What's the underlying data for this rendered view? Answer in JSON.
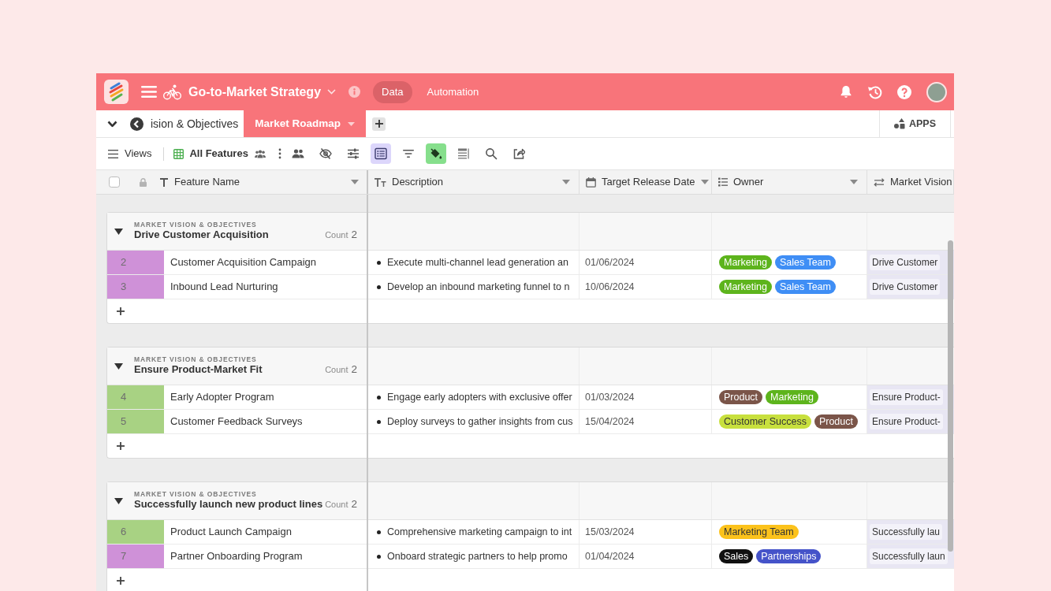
{
  "header": {
    "title": "Go-to-Market Strategy",
    "nav": [
      {
        "label": "Data",
        "selected": true
      },
      {
        "label": "Automation",
        "selected": false
      }
    ]
  },
  "tabs": {
    "items": [
      {
        "label": "ision & Objectives",
        "selected": false
      },
      {
        "label": "Market Roadmap",
        "selected": true
      }
    ],
    "apps_label": "APPS"
  },
  "toolbar": {
    "views_label": "Views",
    "view_name": "All Features",
    "tools": [
      {
        "active": false
      },
      {
        "active": false
      },
      {
        "active": false
      },
      {
        "active": true
      },
      {
        "active": false
      },
      {
        "active": true
      },
      {
        "active": false
      },
      {
        "active": false
      },
      {
        "active": false
      }
    ]
  },
  "table": {
    "select_all": {
      "checked": false
    },
    "columns": [
      {
        "kind": "text",
        "label": "Feature Name"
      },
      {
        "kind": "rich_text",
        "label": "Description"
      },
      {
        "kind": "date",
        "label": "Target Release Date"
      },
      {
        "kind": "multi_select",
        "label": "Owner"
      },
      {
        "kind": "link",
        "label": "Market Vision"
      }
    ],
    "groups": [
      {
        "field_label": "MARKET VISION & OBJECTIVES",
        "title": "Drive Customer Acquisition",
        "count_label": "Count",
        "count": "2",
        "expanded": true,
        "rows": [
          {
            "number": "2",
            "color": "#cf91d8",
            "name": "Customer Acquisition Campaign",
            "description": "Execute multi-channel lead generation an",
            "date": "01/06/2024",
            "owners": [
              {
                "label": "Marketing",
                "color": "#5db41c"
              },
              {
                "label": "Sales Team",
                "color": "#3f8ef5"
              }
            ],
            "market_vision": "Drive Customer"
          },
          {
            "number": "3",
            "color": "#cf91d8",
            "name": "Inbound Lead Nurturing",
            "description": "Develop an inbound marketing funnel to n",
            "date": "10/06/2024",
            "owners": [
              {
                "label": "Marketing",
                "color": "#5db41c"
              },
              {
                "label": "Sales Team",
                "color": "#3f8ef5"
              }
            ],
            "market_vision": "Drive Customer"
          }
        ]
      },
      {
        "field_label": "MARKET VISION & OBJECTIVES",
        "title": "Ensure Product-Market Fit",
        "count_label": "Count",
        "count": "2",
        "expanded": true,
        "rows": [
          {
            "number": "4",
            "color": "#a8d283",
            "name": "Early Adopter Program",
            "description": "Engage early adopters with exclusive offer",
            "date": "01/03/2024",
            "owners": [
              {
                "label": "Product",
                "color": "#7b5549"
              },
              {
                "label": "Marketing",
                "color": "#5db41c"
              }
            ],
            "market_vision": "Ensure Product-"
          },
          {
            "number": "5",
            "color": "#a8d283",
            "name": "Customer Feedback Surveys",
            "description": "Deploy surveys to gather insights from cus",
            "date": "15/04/2024",
            "owners": [
              {
                "label": "Customer Success",
                "color": "#c8e03e"
              },
              {
                "label": "Product",
                "color": "#7b5549"
              }
            ],
            "market_vision": "Ensure Product-"
          }
        ]
      },
      {
        "field_label": "MARKET VISION & OBJECTIVES",
        "title": "Successfully launch new product lines",
        "count_label": "Count",
        "count": "2",
        "expanded": true,
        "rows": [
          {
            "number": "6",
            "color": "#a8d283",
            "name": "Product Launch Campaign",
            "description": "Comprehensive marketing campaign to int",
            "date": "15/03/2024",
            "owners": [
              {
                "label": "Marketing Team",
                "color": "#fcc21b"
              }
            ],
            "market_vision": "Successfully lau"
          },
          {
            "number": "7",
            "color": "#cf91d8",
            "name": "Partner Onboarding Program",
            "description": "Onboard strategic partners to help promo",
            "date": "01/04/2024",
            "owners": [
              {
                "label": "Sales",
                "color": "#111111"
              },
              {
                "label": "Partnerships",
                "color": "#4553c9"
              }
            ],
            "market_vision": "Successfully laun"
          }
        ]
      }
    ]
  }
}
